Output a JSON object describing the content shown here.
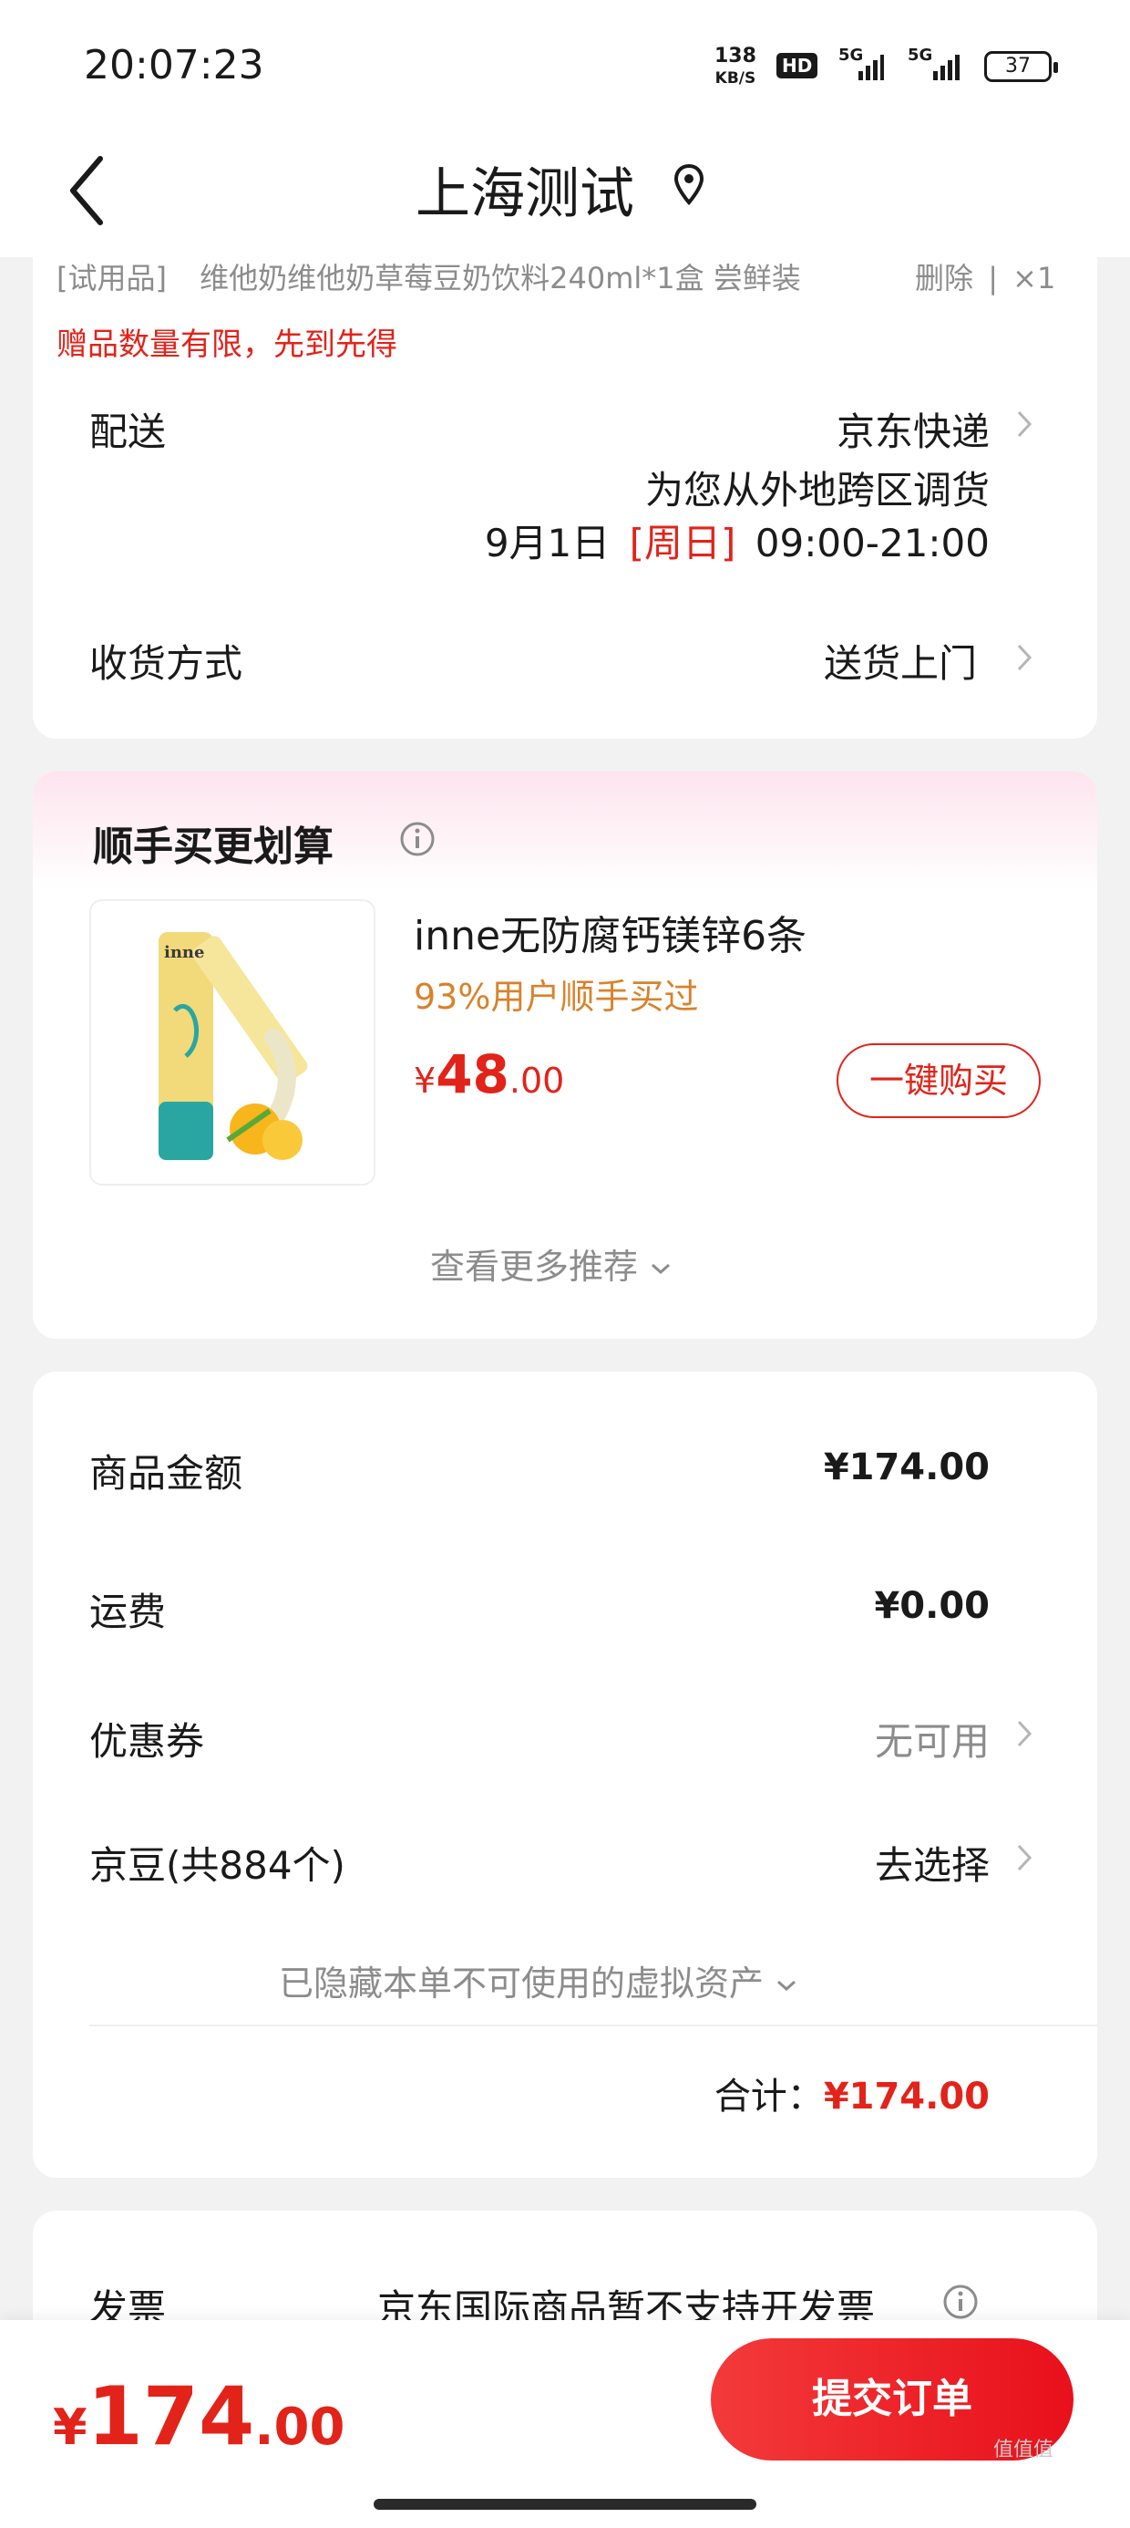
{
  "status_bar": {
    "time": "20:07:23",
    "net_speed_value": "138",
    "net_speed_unit": "KB/S",
    "hd_label": "HD",
    "signal1_label": "5G",
    "signal2_label": "5G",
    "battery": "37"
  },
  "header": {
    "title": "上海测试"
  },
  "order_item": {
    "tag": "[试用品]",
    "name": "维他奶维他奶草莓豆奶饮料240ml*1盒  尝鲜装",
    "delete_label": "删除",
    "separator": "|",
    "quantity": "×1",
    "gift_note": "赠品数量有限，先到先得"
  },
  "delivery": {
    "label": "配送",
    "carrier": "京东快递",
    "note": "为您从外地跨区调货",
    "date": "9月1日",
    "weekday": "[周日]",
    "time_window": "09:00-21:00"
  },
  "receive_method": {
    "label": "收货方式",
    "value": "送货上门"
  },
  "recommend": {
    "title": "顺手买更划算",
    "product_name": "inne无防腐钙镁锌6条",
    "buyers_note": "93%用户顺手买过",
    "price_symbol": "¥",
    "price_int": "48",
    "price_dec": ".00",
    "buy_button": "一键购买",
    "more_label": "查看更多推荐",
    "product_brand_text": "inne"
  },
  "summary": {
    "items_label": "商品金额",
    "items_value": "¥174.00",
    "shipping_label": "运费",
    "shipping_value": "¥0.00",
    "coupon_label": "优惠券",
    "coupon_value": "无可用",
    "beans_label": "京豆(共884个)",
    "beans_value": "去选择",
    "hidden_note": "已隐藏本单不可使用的虚拟资产",
    "total_label": "合计：",
    "total_value": "¥174.00"
  },
  "invoice": {
    "label": "发票",
    "value": "京东国际商品暂不支持开发票"
  },
  "bottom_bar": {
    "price_symbol": "¥",
    "price_int": "174",
    "price_dec": ".00",
    "submit_label": "提交订单"
  },
  "watermark": "值值值",
  "colors": {
    "accent": "#e2231a",
    "orange_note": "#d9822b",
    "muted": "#8c8c8c"
  }
}
